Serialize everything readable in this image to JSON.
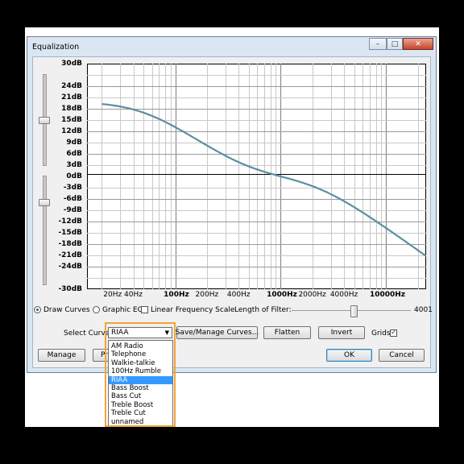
{
  "window": {
    "title": "Equalization"
  },
  "graph": {
    "y_labels": [
      "30dB",
      "24dB",
      "21dB",
      "18dB",
      "15dB",
      "12dB",
      "9dB",
      "6dB",
      "3dB",
      "0dB",
      "-3dB",
      "-6dB",
      "-9dB",
      "-12dB",
      "-15dB",
      "-18dB",
      "-21dB",
      "-24dB",
      "-30dB"
    ],
    "x_labels": [
      {
        "text": "20Hz",
        "bold": false
      },
      {
        "text": "40Hz",
        "bold": false
      },
      {
        "text": "100Hz",
        "bold": true
      },
      {
        "text": "200Hz",
        "bold": false
      },
      {
        "text": "400Hz",
        "bold": false
      },
      {
        "text": "1000Hz",
        "bold": true
      },
      {
        "text": "2000Hz",
        "bold": false
      },
      {
        "text": "4000Hz",
        "bold": false
      },
      {
        "text": "10000Hz",
        "bold": true
      }
    ],
    "curve_color": "#5b8fa0",
    "zero_line_color": "#000000"
  },
  "controls": {
    "draw_curves": "Draw Curves",
    "graphic_eq": "Graphic EQ",
    "linear_scale": "Linear Frequency Scale",
    "length_label": "Length of Filter:",
    "length_value": "4001",
    "length_level": 0.52
  },
  "curve_row": {
    "select_label": "Select Curve:",
    "selected": "RIAA",
    "save_manage": "Save/Manage Curves...",
    "flatten": "Flatten",
    "invert": "Invert",
    "grids": "Grids"
  },
  "bottom": {
    "manage": "Manage",
    "preview": "Pre",
    "ok": "OK",
    "cancel": "Cancel"
  },
  "dropdown": {
    "items": [
      "AM Radio",
      "Telephone",
      "Walkie-talkie",
      "100Hz Rumble",
      "RIAA",
      "Bass Boost",
      "Bass Cut",
      "Treble Boost",
      "Treble Cut",
      "unnamed"
    ],
    "selected_index": 4
  },
  "accent": "#f2a33a"
}
